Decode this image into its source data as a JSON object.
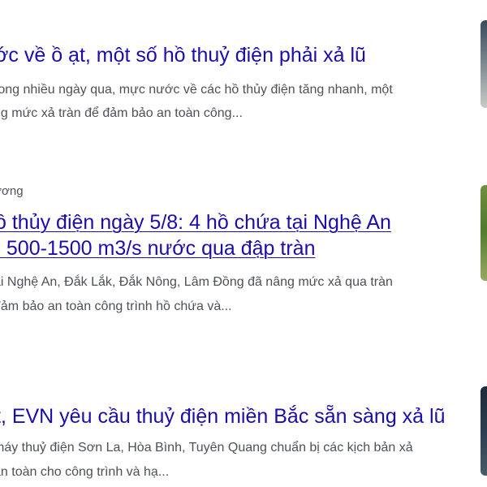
{
  "results": [
    {
      "title_lines": [
        "ớc về ồ ạt, một số hồ thuỷ điện phải xả lũ"
      ],
      "snippet_lines": [
        "rong nhiều ngày qua, mực nước về các hồ thủy điện tăng nhanh, một",
        "ng mức xả tràn để đảm bảo an toàn công..."
      ]
    },
    {
      "source": "ương",
      "title_lines": [
        "ồ thủy điện ngày 5/8: 4 hồ chứa tại Nghệ An",
        "ı 500-1500 m3/s nước qua đập tràn"
      ],
      "snippet_lines": [
        "ại Nghệ An, Đắk Lắk, Đắk Nông, Lâm Đồng đã nâng mức xả qua tràn",
        "đảm bảo an toàn công trình hồ chứa và..."
      ]
    },
    {
      "title_lines": [
        "t, EVN yêu cầu thuỷ điện miền Bắc sẵn sàng xả lũ"
      ],
      "snippet_lines": [
        "máy thuỷ điện Sơn La, Hòa Bình, Tuyên Quang chuẩn bị các kịch bản xả",
        "an toàn cho công trình và hạ..."
      ]
    }
  ]
}
